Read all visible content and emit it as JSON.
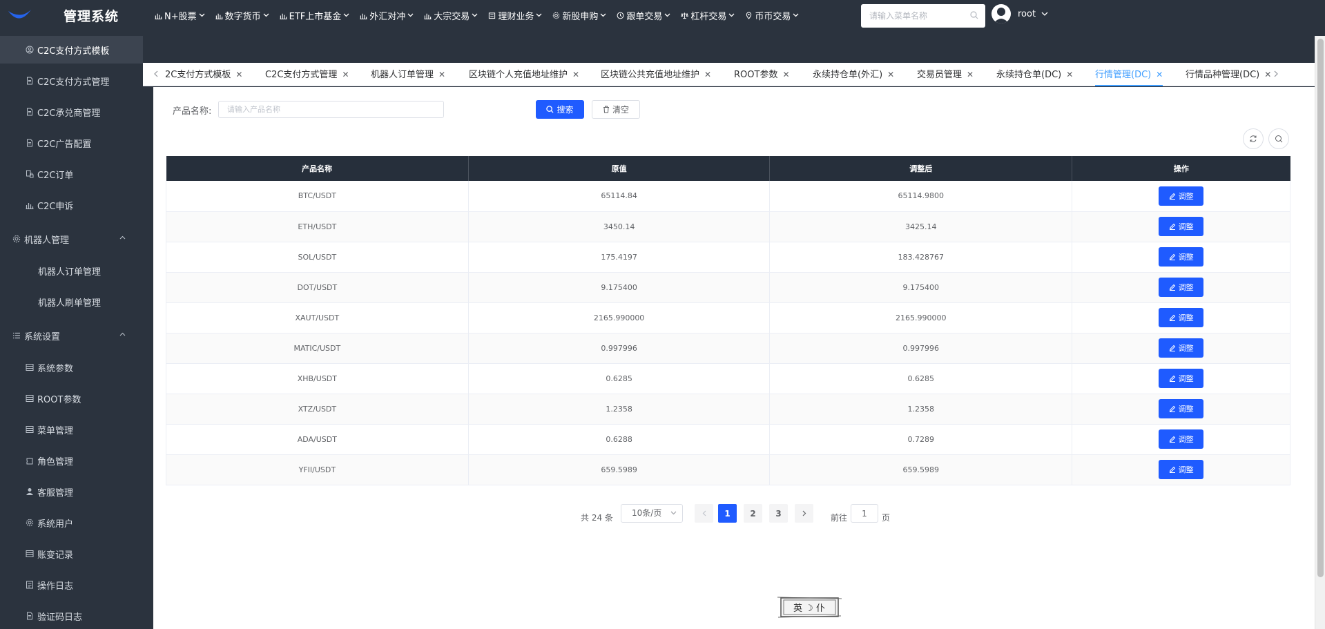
{
  "header": {
    "brand": "管理系统",
    "nav": [
      {
        "label": "N+股票",
        "icon": "bar-chart-icon"
      },
      {
        "label": "数字货币",
        "icon": "bar-chart-icon"
      },
      {
        "label": "ETF上市基金",
        "icon": "bar-chart-icon"
      },
      {
        "label": "外汇对冲",
        "icon": "bar-chart-icon"
      },
      {
        "label": "大宗交易",
        "icon": "bar-chart-icon"
      },
      {
        "label": "理财业务",
        "icon": "finance-icon"
      },
      {
        "label": "新股申购",
        "icon": "gear-icon"
      },
      {
        "label": "跟单交易",
        "icon": "clock-icon"
      },
      {
        "label": "杠杆交易",
        "icon": "balance-icon"
      },
      {
        "label": "币币交易",
        "icon": "location-icon"
      }
    ],
    "menu_search_placeholder": "请输入菜单名称",
    "user_name": "root"
  },
  "sidebar": {
    "items": [
      {
        "label": "C2C支付方式模板",
        "icon": "user-circle-icon",
        "level": 1,
        "active": true
      },
      {
        "label": "C2C支付方式管理",
        "icon": "document-icon",
        "level": 1
      },
      {
        "label": "C2C承兑商管理",
        "icon": "document-icon",
        "level": 1
      },
      {
        "label": "C2C广告配置",
        "icon": "document-icon",
        "level": 1
      },
      {
        "label": "C2C订单",
        "icon": "order-lock-icon",
        "level": 1
      },
      {
        "label": "C2C申诉",
        "icon": "bar-chart-icon",
        "level": 1
      },
      {
        "label": "机器人管理",
        "icon": "gear-icon",
        "level": 0,
        "expanded": true
      },
      {
        "label": "机器人订单管理",
        "icon": "",
        "level": 2
      },
      {
        "label": "机器人刷单管理",
        "icon": "",
        "level": 2
      },
      {
        "label": "系统设置",
        "icon": "list-icon",
        "level": 0,
        "expanded": true
      },
      {
        "label": "系统参数",
        "icon": "table-icon",
        "level": 1
      },
      {
        "label": "ROOT参数",
        "icon": "table-icon",
        "level": 1
      },
      {
        "label": "菜单管理",
        "icon": "table-icon",
        "level": 1
      },
      {
        "label": "角色管理",
        "icon": "puzzle-icon",
        "level": 1
      },
      {
        "label": "客服管理",
        "icon": "person-icon",
        "level": 1
      },
      {
        "label": "系统用户",
        "icon": "gear-icon",
        "level": 1
      },
      {
        "label": "账变记录",
        "icon": "table-icon",
        "level": 1
      },
      {
        "label": "操作日志",
        "icon": "log-icon",
        "level": 1
      },
      {
        "label": "验证码日志",
        "icon": "document-icon",
        "level": 1
      }
    ]
  },
  "tabs": [
    {
      "label": "2C支付方式模板",
      "active": false
    },
    {
      "label": "C2C支付方式管理",
      "active": false
    },
    {
      "label": "机器人订单管理",
      "active": false
    },
    {
      "label": "区块链个人充值地址维护",
      "active": false
    },
    {
      "label": "区块链公共充值地址维护",
      "active": false
    },
    {
      "label": "ROOT参数",
      "active": false
    },
    {
      "label": "永续持仓单(外汇)",
      "active": false
    },
    {
      "label": "交易员管理",
      "active": false
    },
    {
      "label": "永续持仓单(DC)",
      "active": false
    },
    {
      "label": "行情管理(DC)",
      "active": true
    },
    {
      "label": "行情品种管理(DC)",
      "active": false
    }
  ],
  "search": {
    "label": "产品名称:",
    "placeholder": "请输入产品名称",
    "search_btn": "搜索",
    "clear_btn": "清空"
  },
  "table": {
    "columns": [
      "产品名称",
      "原值",
      "调整后",
      "操作"
    ],
    "action_label": "调整",
    "rows": [
      [
        "BTC/USDT",
        "65114.84",
        "65114.9800"
      ],
      [
        "ETH/USDT",
        "3450.14",
        "3425.14"
      ],
      [
        "SOL/USDT",
        "175.4197",
        "183.428767"
      ],
      [
        "DOT/USDT",
        "9.175400",
        "9.175400"
      ],
      [
        "XAUT/USDT",
        "2165.990000",
        "2165.990000"
      ],
      [
        "MATIC/USDT",
        "0.997996",
        "0.997996"
      ],
      [
        "XHB/USDT",
        "0.6285",
        "0.6285"
      ],
      [
        "XTZ/USDT",
        "1.2358",
        "1.2358"
      ],
      [
        "ADA/USDT",
        "0.6288",
        "0.7289"
      ],
      [
        "YFII/USDT",
        "659.5989",
        "659.5989"
      ]
    ]
  },
  "pagination": {
    "total": "共 24 条",
    "page_size": "10条/页",
    "pages": [
      "1",
      "2",
      "3"
    ],
    "current_page": "1",
    "goto_label": "前往",
    "goto_value": "1",
    "page_suffix": "页"
  },
  "lang_stamp": {
    "text": "英 ☽ 仆"
  },
  "colors": {
    "header_bg": "#2b333e",
    "primary": "#1f5bff",
    "tab_active": "#409eff",
    "table_header": "#262f3b"
  }
}
